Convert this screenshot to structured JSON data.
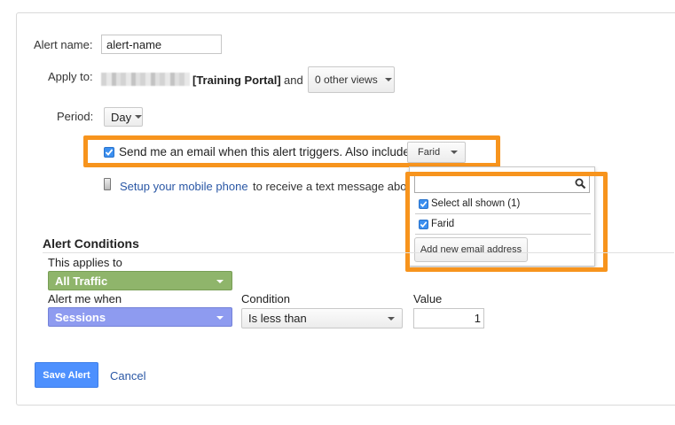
{
  "form": {
    "alert_name_label": "Alert name:",
    "alert_name_value": "alert-name",
    "apply_to_label": "Apply to:",
    "property_name": "[Training Portal]",
    "and_text": "and",
    "views_button": "0 other views",
    "period_label": "Period:",
    "period_value": "Day"
  },
  "email": {
    "label": "Send me an email when this alert triggers. Also include",
    "recipient_button": "Farid",
    "checked": true
  },
  "mobile": {
    "link": "Setup your mobile phone",
    "rest": "to receive a text message abo"
  },
  "recipient_dropdown": {
    "search_value": "",
    "select_all_label": "Select all shown (1)",
    "options": [
      {
        "label": "Farid",
        "checked": true
      }
    ],
    "add_button": "Add new email address"
  },
  "conditions": {
    "heading": "Alert Conditions",
    "applies_to_label": "This applies to",
    "segment_value": "All Traffic",
    "alert_when_label": "Alert me when",
    "metric_value": "Sessions",
    "condition_label": "Condition",
    "condition_value": "Is less than",
    "value_label": "Value",
    "value_input": "1"
  },
  "actions": {
    "save": "Save Alert",
    "cancel": "Cancel"
  },
  "colors": {
    "highlight": "#f7941d",
    "segment": "#8fb56b",
    "metric": "#8e9bf0",
    "primary_button": "#4d90fe",
    "link": "#2a57a5"
  }
}
